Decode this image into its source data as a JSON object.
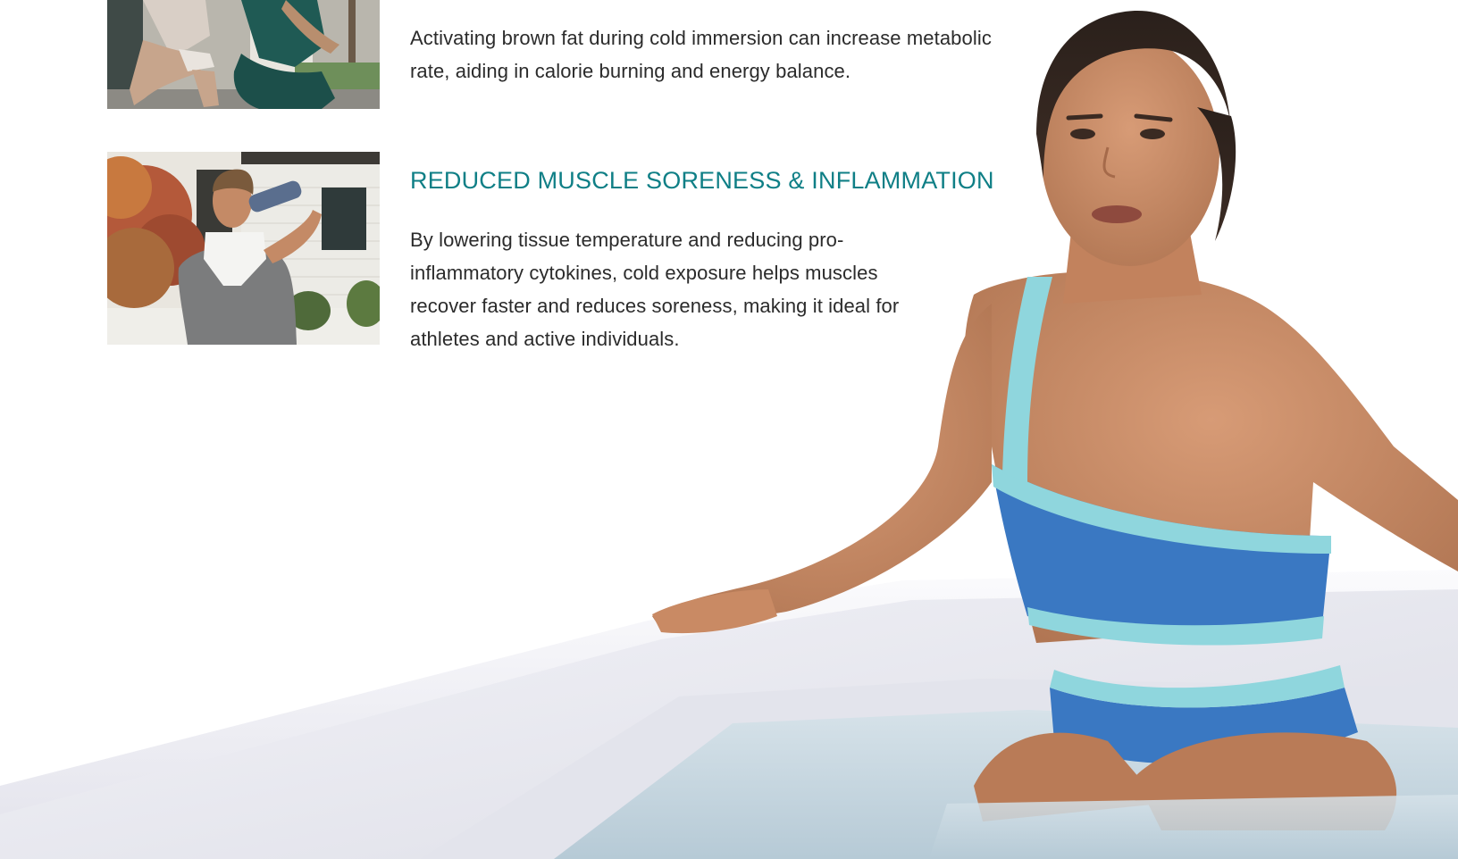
{
  "benefits": [
    {
      "image": "squat-exercise-photo",
      "heading": "",
      "body": "Activating brown fat during cold immersion can increase metabolic rate, aiding in calorie burning and energy balance."
    },
    {
      "image": "man-drinking-water-photo",
      "heading": "REDUCED MUSCLE SORENESS & INFLAMMATION",
      "body": "By lowering tissue temperature and reducing pro-inflammatory cytokines, cold exposure helps muscles recover faster and reduces soreness, making it ideal for athletes and active individuals."
    }
  ],
  "hero": {
    "image": "woman-in-cold-plunge-tub-photo"
  },
  "colors": {
    "heading": "#0f7f86",
    "body_text": "#2b2b2b",
    "swimsuit_blue": "#3a78c2",
    "swimsuit_trim": "#8fd6dd",
    "tub": "#eeeff4",
    "water": "#c9d9e2",
    "skin": "#c98a64"
  }
}
